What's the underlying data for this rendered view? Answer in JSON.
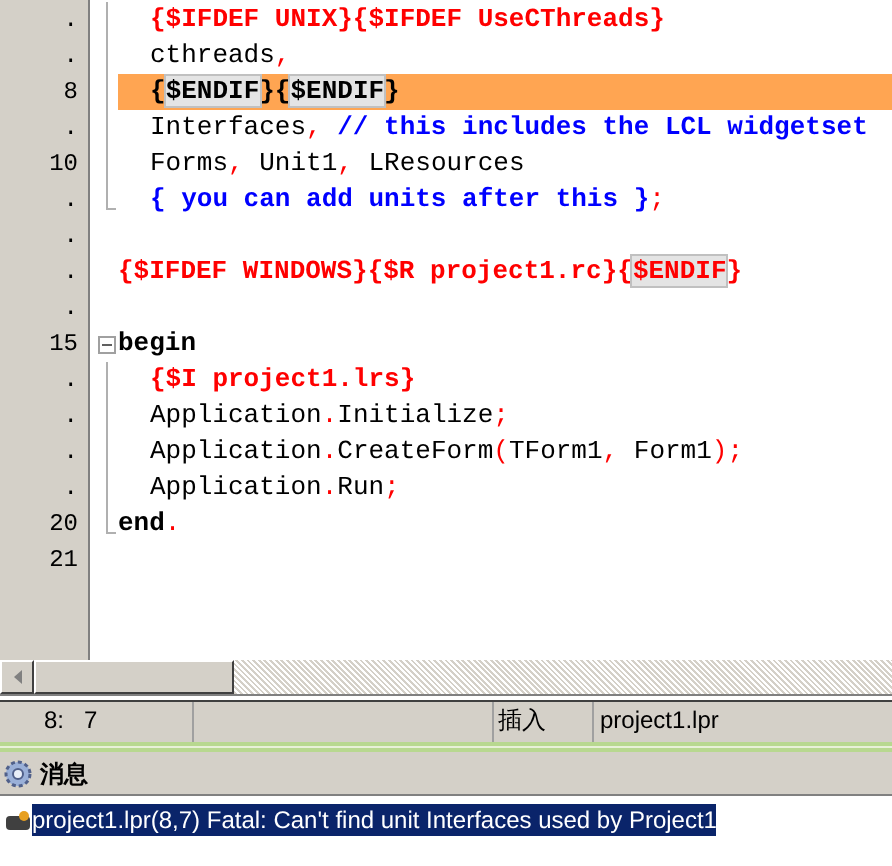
{
  "editor": {
    "lines": [
      {
        "number": ".",
        "kind": "fold_line",
        "indented": true,
        "highlighted": false,
        "segments": [
          {
            "kind": "directive",
            "text": "{$IFDEF UNIX}{$IFDEF UseCThreads}"
          }
        ]
      },
      {
        "number": ".",
        "kind": "fold_line",
        "indented": true,
        "highlighted": false,
        "segments": [
          {
            "kind": "plain",
            "text": "cthreads"
          },
          {
            "kind": "symbol",
            "text": ","
          }
        ]
      },
      {
        "number": "8",
        "kind": "fold_line",
        "indented": true,
        "highlighted": true,
        "segments": [
          {
            "kind": "plain_bold",
            "text": "{"
          },
          {
            "kind": "boxed_plain_bold",
            "text": "$ENDIF"
          },
          {
            "kind": "plain_bold",
            "text": "}{"
          },
          {
            "kind": "boxed_plain_bold",
            "text": "$ENDIF"
          },
          {
            "kind": "plain_bold",
            "text": "}"
          }
        ]
      },
      {
        "number": ".",
        "kind": "fold_line",
        "indented": true,
        "highlighted": false,
        "segments": [
          {
            "kind": "plain",
            "text": "Interfaces"
          },
          {
            "kind": "symbol",
            "text": ", "
          },
          {
            "kind": "comment",
            "text": "// this includes the LCL widgetset"
          }
        ]
      },
      {
        "number": "10",
        "kind": "fold_line",
        "indented": true,
        "highlighted": false,
        "segments": [
          {
            "kind": "plain",
            "text": "Forms"
          },
          {
            "kind": "symbol",
            "text": ", "
          },
          {
            "kind": "plain",
            "text": "Unit1"
          },
          {
            "kind": "symbol",
            "text": ", "
          },
          {
            "kind": "plain",
            "text": "LResources"
          }
        ]
      },
      {
        "number": ".",
        "kind": "fold_end",
        "indented": true,
        "highlighted": false,
        "segments": [
          {
            "kind": "comment",
            "text": "{ you can add units after this }"
          },
          {
            "kind": "symbol",
            "text": ";"
          }
        ]
      },
      {
        "number": ".",
        "kind": "plain"
      },
      {
        "number": ".",
        "kind": "plain",
        "indented": false,
        "highlighted": false,
        "segments": [
          {
            "kind": "directive",
            "text": "{$IFDEF WINDOWS}{$R project1.rc}{"
          },
          {
            "kind": "boxed_directive",
            "text": "$ENDIF"
          },
          {
            "kind": "directive",
            "text": "}"
          }
        ]
      },
      {
        "number": ".",
        "kind": "plain"
      },
      {
        "number": "15",
        "kind": "fold_start",
        "indented": false,
        "highlighted": false,
        "segments": [
          {
            "kind": "keyword",
            "text": "begin"
          }
        ]
      },
      {
        "number": ".",
        "kind": "fold_line",
        "indented": true,
        "highlighted": false,
        "segments": [
          {
            "kind": "directive",
            "text": "{$I project1.lrs}"
          }
        ]
      },
      {
        "number": ".",
        "kind": "fold_line",
        "indented": true,
        "highlighted": false,
        "segments": [
          {
            "kind": "plain",
            "text": "Application"
          },
          {
            "kind": "symbol",
            "text": "."
          },
          {
            "kind": "plain",
            "text": "Initialize"
          },
          {
            "kind": "symbol",
            "text": ";"
          }
        ]
      },
      {
        "number": ".",
        "kind": "fold_line",
        "indented": true,
        "highlighted": false,
        "segments": [
          {
            "kind": "plain",
            "text": "Application"
          },
          {
            "kind": "symbol",
            "text": "."
          },
          {
            "kind": "plain",
            "text": "CreateForm"
          },
          {
            "kind": "symbol",
            "text": "("
          },
          {
            "kind": "plain",
            "text": "TForm1"
          },
          {
            "kind": "symbol",
            "text": ", "
          },
          {
            "kind": "plain",
            "text": "Form1"
          },
          {
            "kind": "symbol",
            "text": ");"
          }
        ]
      },
      {
        "number": ".",
        "kind": "fold_line",
        "indented": true,
        "highlighted": false,
        "segments": [
          {
            "kind": "plain",
            "text": "Application"
          },
          {
            "kind": "symbol",
            "text": "."
          },
          {
            "kind": "plain",
            "text": "Run"
          },
          {
            "kind": "symbol",
            "text": ";"
          }
        ]
      },
      {
        "number": "20",
        "kind": "fold_end",
        "indented": false,
        "highlighted": false,
        "segments": [
          {
            "kind": "keyword",
            "text": "end"
          },
          {
            "kind": "symbol",
            "text": "."
          }
        ]
      },
      {
        "number": "21",
        "kind": "plain"
      }
    ]
  },
  "status_bar": {
    "position": "8:   7",
    "mode": "插入",
    "file": "project1.lpr"
  },
  "messages": {
    "title": "消息",
    "items": [
      {
        "text": "project1.lpr(8,7) Fatal: Can't find unit Interfaces used by Project1",
        "selected": true
      }
    ]
  }
}
